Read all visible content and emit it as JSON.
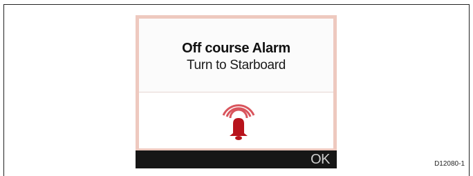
{
  "alarm_dialog": {
    "title": "Off course Alarm",
    "message": "Turn to Starboard",
    "icon": "alarm-bell-icon"
  },
  "softkeys": {
    "ok_label": "OK"
  },
  "figure": {
    "reference": "D12080-1"
  },
  "colors": {
    "screen_border": "#eec9bf",
    "softkey_bar": "#161616",
    "alarm_red": "#c8202a"
  }
}
